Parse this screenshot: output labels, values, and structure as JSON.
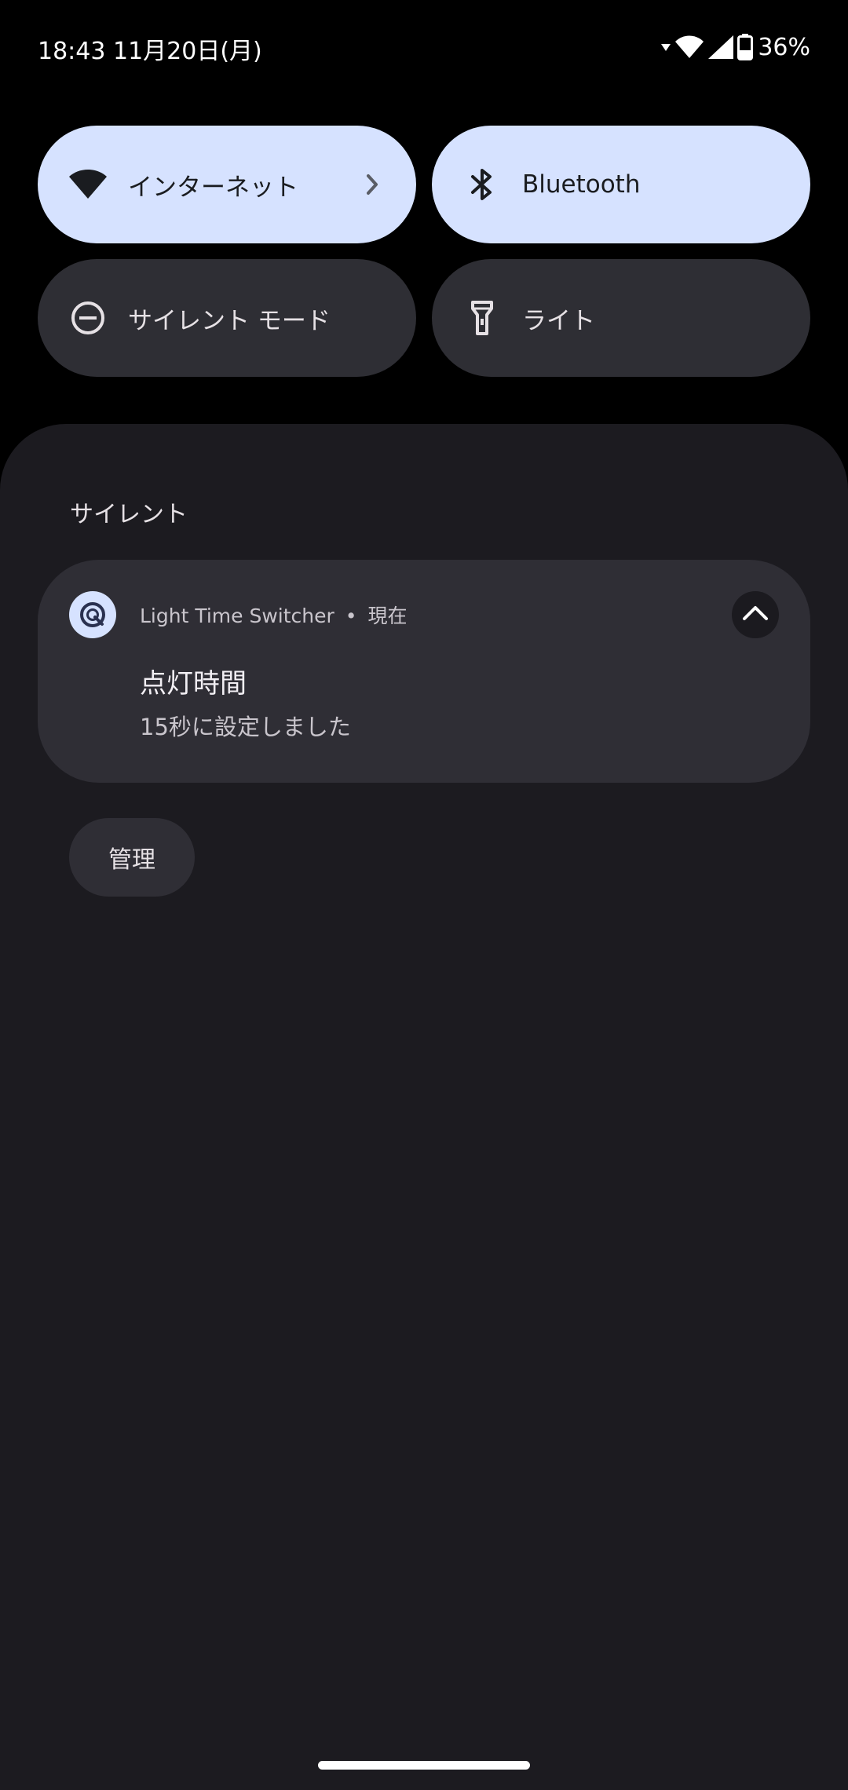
{
  "status_bar": {
    "time_date": "18:43 11月20日(月)",
    "battery_percent": "36%",
    "icons": [
      "data-activity-icon",
      "wifi-icon",
      "cell-signal-icon",
      "battery-icon"
    ]
  },
  "quick_settings": {
    "tiles": [
      {
        "label": "インターネット",
        "icon": "wifi-icon",
        "state": "on",
        "has_chevron": true
      },
      {
        "label": "Bluetooth",
        "icon": "bluetooth-icon",
        "state": "on"
      },
      {
        "label": "サイレント モード",
        "icon": "do-not-disturb-icon",
        "state": "off"
      },
      {
        "label": "ライト",
        "icon": "flashlight-icon",
        "state": "off"
      }
    ]
  },
  "notifications": {
    "section_header": "サイレント",
    "items": [
      {
        "app_name": "Light Time Switcher",
        "separator": "•",
        "time": "現在",
        "title": "点灯時間",
        "text": "15秒に設定しました",
        "app_icon": "app-icon",
        "expanded": true
      }
    ],
    "manage_label": "管理"
  },
  "colors": {
    "tile_active": "#d6e2ff",
    "tile_inactive": "#2e2e34",
    "shade_background": "#1c1b20",
    "card_background": "#2f2e35"
  }
}
